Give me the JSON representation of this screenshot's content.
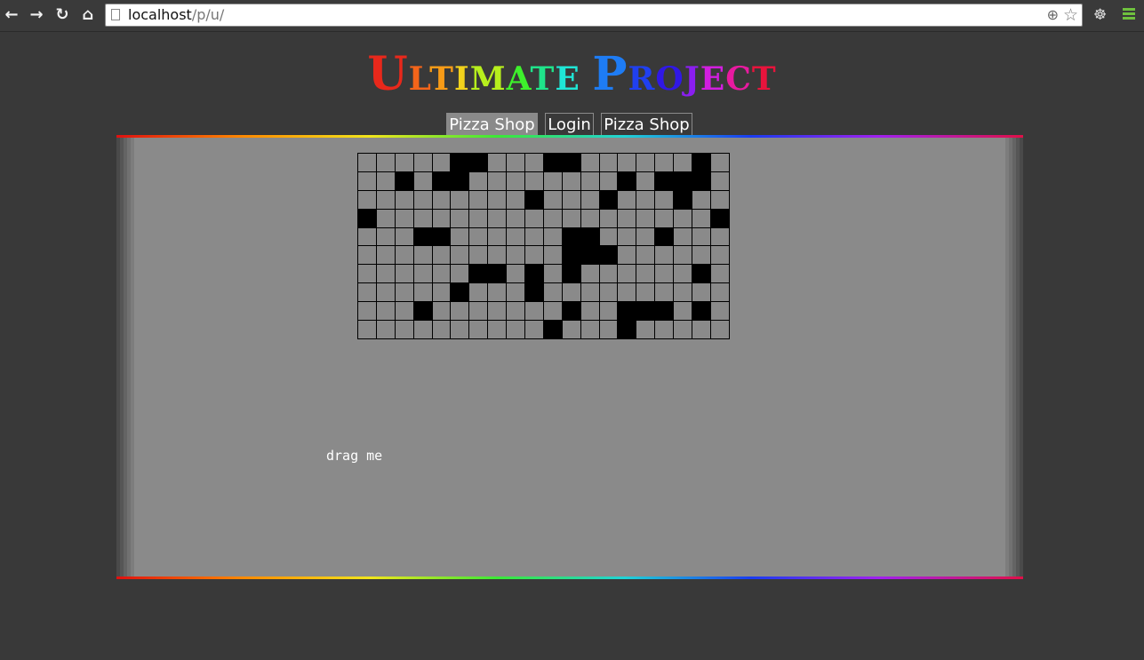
{
  "browser": {
    "url_host": "localhost",
    "url_path": "/p/u/"
  },
  "header": {
    "title_parts": [
      {
        "text": "U",
        "color": "#e8281b",
        "big": true
      },
      {
        "text": "L",
        "color": "#f4651a",
        "big": false
      },
      {
        "text": "T",
        "color": "#f79b17",
        "big": false
      },
      {
        "text": "I",
        "color": "#f2d21c",
        "big": false
      },
      {
        "text": "M",
        "color": "#b7ef1d",
        "big": false
      },
      {
        "text": "A",
        "color": "#3ef12c",
        "big": false
      },
      {
        "text": "T",
        "color": "#1fe38a",
        "big": false
      },
      {
        "text": "E",
        "color": "#1fe6d6",
        "big": false
      },
      {
        "text": " ",
        "color": "#ffffff",
        "big": false
      },
      {
        "text": "P",
        "color": "#1e7cf4",
        "big": true
      },
      {
        "text": "R",
        "color": "#2040f0",
        "big": false
      },
      {
        "text": "O",
        "color": "#3018e6",
        "big": false
      },
      {
        "text": "J",
        "color": "#8a1ef0",
        "big": false
      },
      {
        "text": "E",
        "color": "#d21ee0",
        "big": false
      },
      {
        "text": "C",
        "color": "#e81aa0",
        "big": false
      },
      {
        "text": "T",
        "color": "#e8143c",
        "big": false
      }
    ]
  },
  "nav": {
    "items": [
      {
        "label": "Pizza Shop"
      },
      {
        "label": "Login"
      },
      {
        "label": "Pizza Shop"
      }
    ]
  },
  "grid": {
    "rows": 10,
    "cols": 20,
    "filled": [
      [
        0,
        5
      ],
      [
        0,
        6
      ],
      [
        0,
        10
      ],
      [
        0,
        11
      ],
      [
        0,
        18
      ],
      [
        1,
        2
      ],
      [
        1,
        4
      ],
      [
        1,
        5
      ],
      [
        1,
        14
      ],
      [
        1,
        16
      ],
      [
        1,
        17
      ],
      [
        1,
        18
      ],
      [
        2,
        9
      ],
      [
        2,
        13
      ],
      [
        2,
        17
      ],
      [
        3,
        0
      ],
      [
        3,
        19
      ],
      [
        4,
        3
      ],
      [
        4,
        4
      ],
      [
        4,
        11
      ],
      [
        4,
        12
      ],
      [
        4,
        16
      ],
      [
        5,
        11
      ],
      [
        5,
        12
      ],
      [
        5,
        13
      ],
      [
        6,
        6
      ],
      [
        6,
        7
      ],
      [
        6,
        9
      ],
      [
        6,
        11
      ],
      [
        6,
        18
      ],
      [
        7,
        5
      ],
      [
        7,
        9
      ],
      [
        8,
        3
      ],
      [
        8,
        11
      ],
      [
        8,
        14
      ],
      [
        8,
        15
      ],
      [
        8,
        16
      ],
      [
        8,
        18
      ],
      [
        9,
        10
      ],
      [
        9,
        14
      ]
    ]
  },
  "main": {
    "drag_label": "drag me"
  }
}
